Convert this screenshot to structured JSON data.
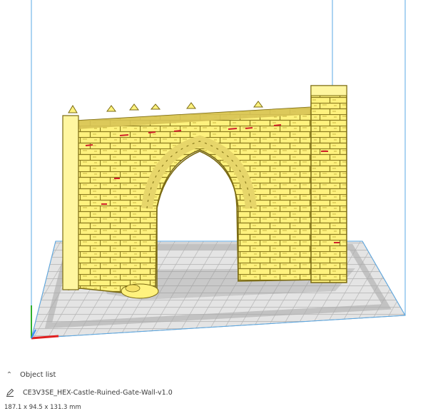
{
  "viewport": {
    "build_volume_color": "#5aa9e6",
    "bed_color": "#c9c9c9",
    "model_color": "#ffea70",
    "shadow_color": "#b8b8b8",
    "overhang_color": "#d0202a",
    "axis_x_color": "#e02020",
    "axis_y_color": "#3a8cff",
    "axis_z_color": "#30b030"
  },
  "object_list": {
    "header_label": "Object list",
    "expand_icon": "chevron-up-icon",
    "edit_icon": "pencil-icon",
    "object_name": "CE3V3SE_HEX-Castle-Ruined-Gate-Wall-v1.0",
    "dimensions": "187.1 x 94.5 x 131.3 mm"
  }
}
